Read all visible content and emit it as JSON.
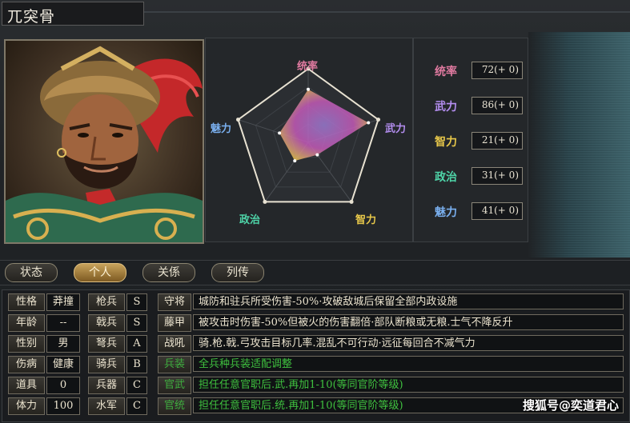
{
  "general": {
    "name": "兀突骨"
  },
  "radar": {
    "labels": {
      "tongshuai": "统率",
      "wuli": "武力",
      "zhili": "智力",
      "zhengzhi": "政治",
      "meili": "魅力"
    },
    "max": 100,
    "values": [
      72,
      86,
      21,
      31,
      41
    ]
  },
  "stats": [
    {
      "label": "统率",
      "value": "72(+ 0)",
      "color": "#e07aa0"
    },
    {
      "label": "武力",
      "value": "86(+ 0)",
      "color": "#b48ef0"
    },
    {
      "label": "智力",
      "value": "21(+ 0)",
      "color": "#e8c84a"
    },
    {
      "label": "政治",
      "value": "31(+ 0)",
      "color": "#4ed4a8"
    },
    {
      "label": "魅力",
      "value": "41(+ 0)",
      "color": "#7ab0f0"
    }
  ],
  "tabs": [
    {
      "label": "状态",
      "active": false
    },
    {
      "label": "个人",
      "active": true
    },
    {
      "label": "关係",
      "active": false
    },
    {
      "label": "列传",
      "active": false
    }
  ],
  "personal": [
    {
      "label": "性格",
      "value": "莽撞"
    },
    {
      "label": "年龄",
      "value": "--"
    },
    {
      "label": "性别",
      "value": "男"
    },
    {
      "label": "伤病",
      "value": "健康"
    },
    {
      "label": "道具",
      "value": "0"
    },
    {
      "label": "体力",
      "value": "100"
    }
  ],
  "aptitude": [
    {
      "label": "枪兵",
      "value": "S"
    },
    {
      "label": "戟兵",
      "value": "S"
    },
    {
      "label": "弩兵",
      "value": "A"
    },
    {
      "label": "骑兵",
      "value": "B"
    },
    {
      "label": "兵器",
      "value": "C"
    },
    {
      "label": "水军",
      "value": "C"
    }
  ],
  "skills": [
    {
      "label": "守将",
      "desc": "城防和驻兵所受伤害-50%·攻破敌城后保留全部内政设施",
      "green": false
    },
    {
      "label": "藤甲",
      "desc": "被攻击时伤害-50%但被火的伤害翻倍·部队断粮或无粮.士气不降反升",
      "green": false
    },
    {
      "label": "战吼",
      "desc": "骑.枪.戟.弓攻击目标几率.混乱不可行动·远征每回合不减气力",
      "green": false
    },
    {
      "label": "兵装",
      "desc": "全兵种兵装适配调整",
      "green": true
    },
    {
      "label": "官武",
      "desc": "担任任意官职后.武.再加1-10(等同官阶等级)",
      "green": true
    },
    {
      "label": "官统",
      "desc": "担任任意官职后.统.再加1-10(等同官阶等级)",
      "green": true
    }
  ],
  "watermark": "搜狐号@奕道君心",
  "colors": {
    "accent_active_tab": "#c8a35c",
    "skill_green": "#3fc03f",
    "radar_fill": "#c45ab8"
  }
}
